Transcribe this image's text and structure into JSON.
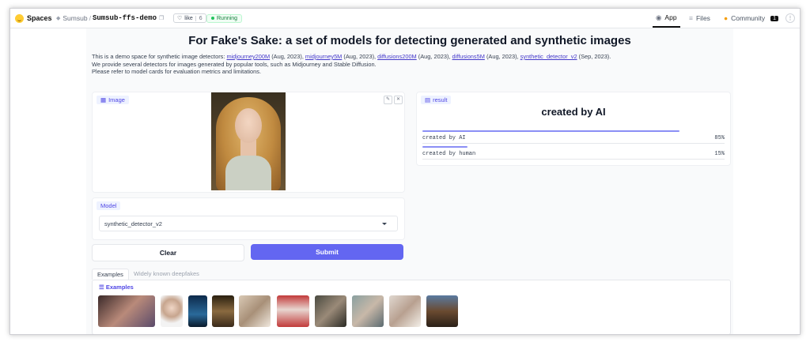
{
  "topbar": {
    "spaces_label": "Spaces",
    "org": "Sumsub",
    "repo": "Sumsub-ffs-demo",
    "like_label": "like",
    "like_count": "6",
    "status": "Running",
    "nav": [
      {
        "label": "App",
        "active": true
      },
      {
        "label": "Files",
        "active": false
      },
      {
        "label": "Community",
        "active": false,
        "badge": "1"
      }
    ]
  },
  "page": {
    "title": "For Fake's Sake: a set of models for detecting generated and synthetic images",
    "intro_prefix": "This is a demo space for synthetic image detectors: ",
    "detectors": [
      {
        "name": "midjourney200M",
        "date": "(Aug, 2023)"
      },
      {
        "name": "midjourney5M",
        "date": "(Aug, 2023)"
      },
      {
        "name": "diffusions200M",
        "date": "(Aug, 2023)"
      },
      {
        "name": "diffusions5M",
        "date": "(Aug, 2023)"
      },
      {
        "name": "synthetic_detector_v2",
        "date": "(Sep, 2023)."
      }
    ],
    "line2": "We provide several detectors for images generated by popular tools, such as Midjourney and Stable Diffusion.",
    "line3": "Please refer to model cards for evaluation metrics and limitations."
  },
  "image_panel": {
    "label": "Image",
    "edit_icon": "✎",
    "close_icon": "✕"
  },
  "result_panel": {
    "label": "result",
    "headline": "created by AI",
    "rows": [
      {
        "label": "created by AI",
        "value": "85%",
        "fraction": 0.85
      },
      {
        "label": "created by human",
        "value": "15%",
        "fraction": 0.15
      }
    ]
  },
  "model": {
    "label": "Model",
    "selected": "synthetic_detector_v2"
  },
  "buttons": {
    "clear": "Clear",
    "submit": "Submit"
  },
  "tabs": [
    {
      "label": "Examples",
      "active": true
    },
    {
      "label": "Widely known deepfakes",
      "active": false
    }
  ],
  "examples": {
    "label": "Examples"
  },
  "colors": {
    "accent": "#6366f1",
    "bar": "#8b8ff5",
    "running": "#22c55e"
  }
}
